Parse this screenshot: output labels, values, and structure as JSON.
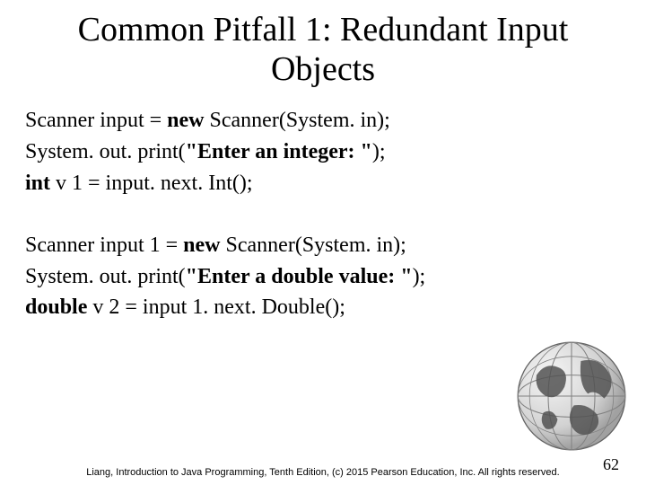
{
  "title": "Common Pitfall 1: Redundant Input Objects",
  "code_block1": {
    "line1_a": "Scanner input = ",
    "line1_b": "new ",
    "line1_c": "Scanner(System. in);",
    "line2_a": "System. out. print(",
    "line2_b": "\"Enter an integer: \"",
    "line2_c": ");",
    "line3_a": "int ",
    "line3_b": "v 1 = input. next. Int();"
  },
  "code_block2": {
    "line1_a": "Scanner input 1 = ",
    "line1_b": "new ",
    "line1_c": "Scanner(System. in);",
    "line2_a": "System. out. print(",
    "line2_b": "\"Enter a double value: \"",
    "line2_c": ");",
    "line3_a": "double ",
    "line3_b": "v 2 = input 1. next. Double();"
  },
  "footer": "Liang, Introduction to Java Programming, Tenth Edition, (c) 2015 Pearson Education, Inc. All rights reserved.",
  "page_number": "62"
}
